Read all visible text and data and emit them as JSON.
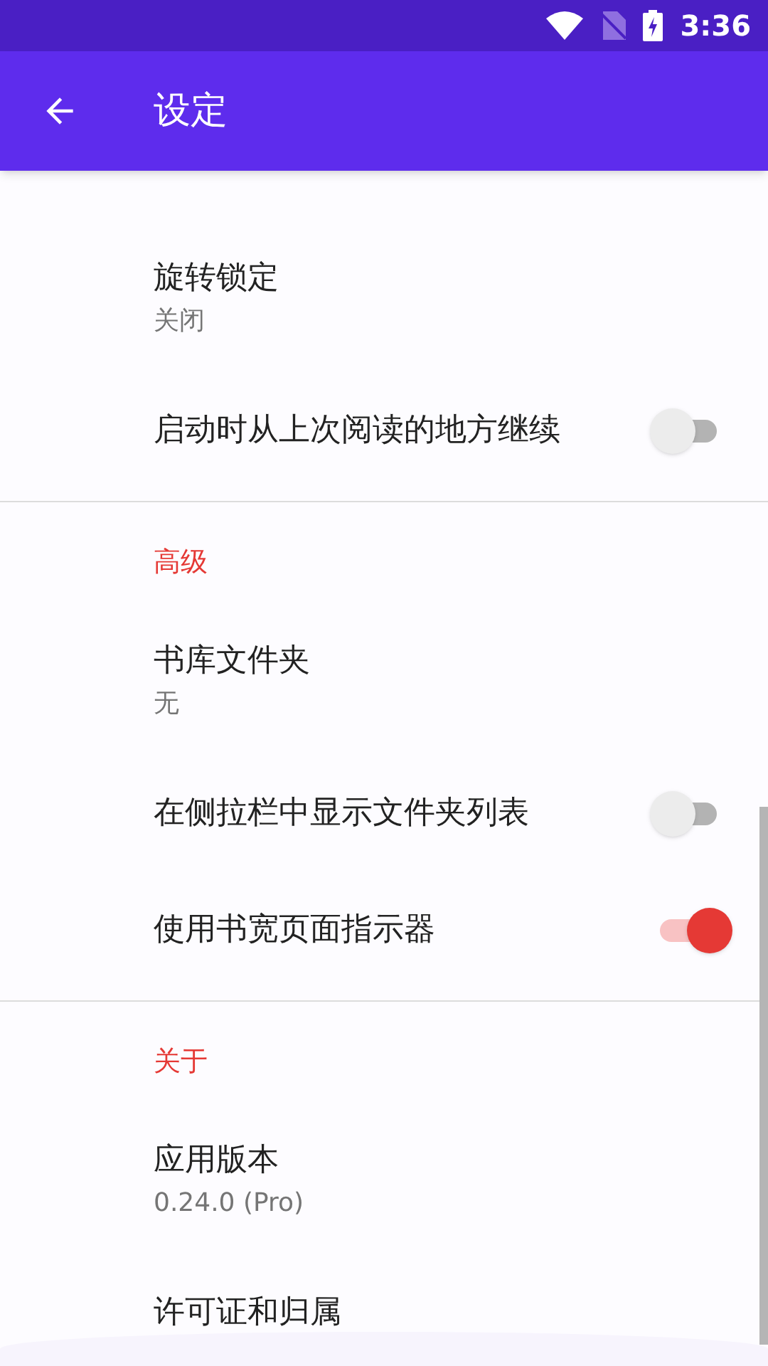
{
  "status_bar": {
    "time": "3:36"
  },
  "app_bar": {
    "title": "设定"
  },
  "sections": [
    {
      "items": [
        {
          "kind": "value",
          "title": "旋转锁定",
          "summary": "关闭"
        },
        {
          "kind": "switch",
          "title": "启动时从上次阅读的地方继续",
          "on": false
        }
      ]
    },
    {
      "header": "高级",
      "items": [
        {
          "kind": "value",
          "title": "书库文件夹",
          "summary": "无"
        },
        {
          "kind": "switch",
          "title": "在侧拉栏中显示文件夹列表",
          "on": false
        },
        {
          "kind": "switch",
          "title": "使用书宽页面指示器",
          "on": true
        }
      ]
    },
    {
      "header": "关于",
      "items": [
        {
          "kind": "value",
          "title": "应用版本",
          "summary": "0.24.0 (Pro)"
        },
        {
          "kind": "plain",
          "title": "许可证和归属"
        }
      ]
    }
  ]
}
